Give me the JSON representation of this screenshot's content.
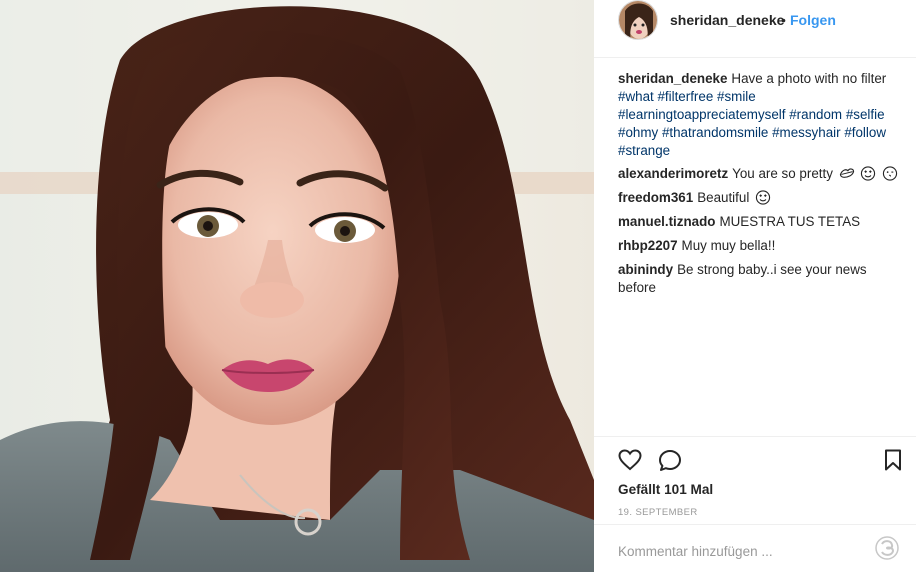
{
  "post": {
    "username": "sheridan_deneke",
    "separator": "•",
    "follow_label": "Folgen",
    "caption": {
      "username": "sheridan_deneke",
      "text": "Have a photo with no filter",
      "hashtags": [
        "#what",
        "#filterfree",
        "#smile",
        "#learningtoappreciatemyself",
        "#random",
        "#selfie",
        "#ohmy",
        "#thatrandomsmile",
        "#messyhair",
        "#follow",
        "#strange"
      ]
    },
    "comments": [
      {
        "username": "alexanderimoretz",
        "text": "You are so pretty",
        "emojis": [
          "kiss-mark-icon",
          "heart-eyes-icon",
          "kiss-face-icon"
        ]
      },
      {
        "username": "freedom361",
        "text": "Beautiful",
        "emojis": [
          "heart-eyes-icon"
        ]
      },
      {
        "username": "manuel.tiznado",
        "text": "MUESTRA TUS TETAS"
      },
      {
        "username": "rhbp2207",
        "text": "Muy muy bella!!"
      },
      {
        "username": "abinindy",
        "text": "Be strong baby..i see your news before"
      }
    ],
    "likes_label": "Gefällt 101 Mal",
    "date_label": "19. SEPTEMBER",
    "add_comment_placeholder": "Kommentar hinzufügen ..."
  },
  "icons": {
    "like": "heart-icon",
    "comment": "comment-bubble-icon",
    "save": "bookmark-icon",
    "extension": "plugin-swirl-icon"
  },
  "colors": {
    "link_blue": "#3897f0",
    "hashtag": "#003569",
    "muted": "#999999",
    "text": "#262626"
  }
}
